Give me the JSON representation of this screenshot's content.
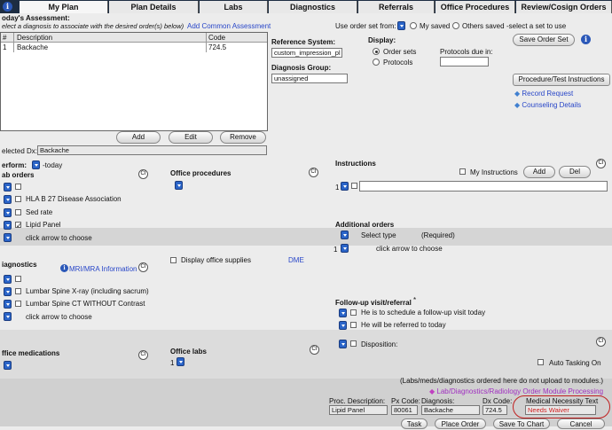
{
  "tabs": [
    {
      "label": "My Plan",
      "active": true
    },
    {
      "label": "Plan Details"
    },
    {
      "label": "Labs"
    },
    {
      "label": "Diagnostics"
    },
    {
      "label": "Referrals"
    },
    {
      "label": "Office Procedures"
    },
    {
      "label": "Review/Cosign Orders"
    }
  ],
  "assessment": {
    "title": "oday's Assessment:",
    "subtitle": "elect a diagnosis to associate with the desired order(s) below)",
    "add_common": "Add Common Assessment",
    "headers": [
      "#",
      "Description",
      "Code"
    ],
    "rows": [
      {
        "num": "1",
        "description": "Backache",
        "code": "724.5"
      }
    ],
    "add_btn": "Add",
    "edit_btn": "Edit",
    "remove_btn": "Remove",
    "selected_dx_label": "elected Dx:",
    "selected_dx_value": "Backache"
  },
  "reference": {
    "system_label": "Reference System:",
    "system_value": "custom_impression_pl",
    "group_label": "Diagnosis Group:",
    "group_value": "unassigned"
  },
  "display": {
    "label": "Display:",
    "order_sets": "Order sets",
    "protocols": "Protocols",
    "protocols_due": "Protocols due in:"
  },
  "order_set": {
    "use_from": "Use order set from:",
    "my_saved": "My saved",
    "others_saved": "Others saved",
    "select_hint": "-select a set to use",
    "save_btn": "Save Order Set",
    "proc_instr_btn": "Procedure/Test Instructions",
    "record_request": "Record Request",
    "counseling_details": "Counseling Details"
  },
  "perform": {
    "label": "erform:",
    "value": "-today"
  },
  "lab_orders": {
    "title": "ab orders",
    "items": [
      {
        "label": "",
        "checked": false
      },
      {
        "label": "HLA B 27 Disease Association",
        "checked": false
      },
      {
        "label": "Sed rate",
        "checked": false
      },
      {
        "label": "Lipid Panel",
        "checked": true
      },
      {
        "label": "click arrow to choose",
        "checked": null
      }
    ]
  },
  "office_procedures": {
    "title": "Office procedures"
  },
  "instructions": {
    "title": "Instructions",
    "my_instructions": "My Instructions",
    "add_btn": "Add",
    "del_btn": "Del",
    "count": "1"
  },
  "additional_orders": {
    "title": "Additional orders",
    "select_type": "Select type",
    "required": "(Required)",
    "count": "1",
    "click_hint": "click arrow to choose"
  },
  "diagnostics": {
    "title": "iagnostics",
    "mri_info": "MRI/MRA Information",
    "display_supplies": "Display office supplies",
    "dme": "DME",
    "items": [
      {
        "label": "",
        "checked": false
      },
      {
        "label": "Lumbar Spine X-ray (including sacrum)",
        "checked": false
      },
      {
        "label": "Lumbar Spine CT WITHOUT Contrast",
        "checked": false
      },
      {
        "label": "click arrow to choose",
        "checked": null
      }
    ]
  },
  "followup": {
    "title": "Follow-up visit/referral",
    "asterisk": "*",
    "item1": "He is to schedule a follow-up visit today",
    "item2": "He will be referred to today",
    "disposition": "Disposition:"
  },
  "office_medications": {
    "title": "ffice medications"
  },
  "office_labs": {
    "title": "Office labs",
    "count": "1"
  },
  "ci_label": "CI",
  "auto_tasking": "Auto Tasking On",
  "footer": {
    "note": "(Labs/meds/diagnostics ordered here do not upload to modules.)",
    "module_link": "Lab/Diagnostics/Radiology Order Module Processing",
    "headers": [
      "Proc. Description:",
      "Px Code:",
      "Diagnosis:",
      "Dx Code:",
      "Medical Necessity Text"
    ],
    "values": [
      "Lipid Panel",
      "80061",
      "Backache",
      "724.5",
      "Needs Waiver"
    ],
    "buttons": [
      "Task",
      "Place Order",
      "Save To Chart",
      "Cancel"
    ]
  },
  "colors": {
    "accent": "#2a64c8",
    "warning": "#d02020",
    "tabbar": "#1d2d42"
  }
}
